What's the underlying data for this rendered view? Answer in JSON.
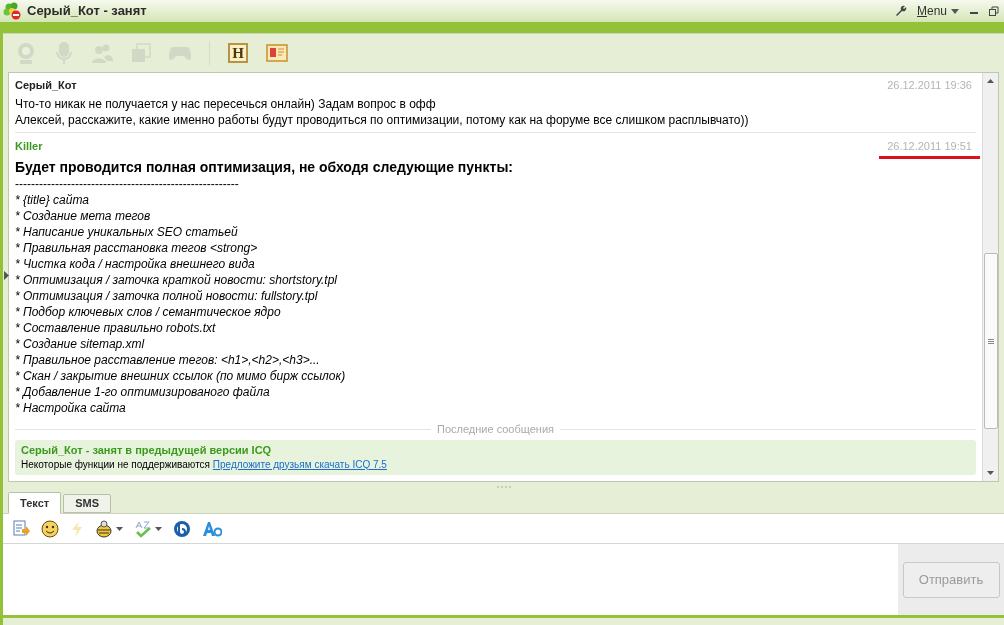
{
  "window": {
    "title": "Серый_Кот - занят",
    "menu": "Menu"
  },
  "toolbar": [
    {
      "kind": "webcam",
      "disabled": true
    },
    {
      "kind": "mic",
      "disabled": true
    },
    {
      "kind": "people",
      "disabled": true
    },
    {
      "kind": "windows",
      "disabled": true
    },
    {
      "kind": "gamepad",
      "disabled": true
    },
    {
      "kind": "separator"
    },
    {
      "kind": "letter",
      "label": "H",
      "disabled": false
    },
    {
      "kind": "card",
      "disabled": false
    }
  ],
  "messages": [
    {
      "sender": "Серый_Кот",
      "own": false,
      "time": "26.12.2011 19:36",
      "highlighted": false,
      "lines": [
        {
          "kind": "plain",
          "text": "Что-то никак не получается у нас пересечься онлайн) Задам вопрос в офф"
        },
        {
          "kind": "plain",
          "text": "Алексей, расскажите, какие именно работы будут проводиться по оптимизации, потому как на форуме все слишком расплывчато))"
        }
      ]
    },
    {
      "sender": "Killer",
      "own": true,
      "time": "26.12.2011 19:51",
      "highlighted": true,
      "lines": [
        {
          "kind": "bold",
          "text": "Будет проводится полная оптимизация, не обходя следующие пункты:"
        },
        {
          "kind": "plain",
          "text": "--------------------------------------------------------"
        },
        {
          "kind": "italic",
          "text": "* {title} сайта"
        },
        {
          "kind": "italic",
          "text": "* Создание мета тегов"
        },
        {
          "kind": "italic",
          "text": "* Написание уникальных SEO статьей"
        },
        {
          "kind": "italic",
          "text": "* Правильная расстановка тегов <strong>"
        },
        {
          "kind": "italic",
          "text": "* Чистка кода / настройка внешнего вида"
        },
        {
          "kind": "italic",
          "text": "* Оптимизация / заточка краткой новости: shortstory.tpl"
        },
        {
          "kind": "italic",
          "text": "* Оптимизация / заточка полной новости: fullstory.tpl"
        },
        {
          "kind": "italic",
          "text": "* Подбор ключевых слов / семантическое ядро"
        },
        {
          "kind": "italic",
          "text": "* Составление правильно robots.txt"
        },
        {
          "kind": "italic",
          "text": "* Создание sitemap.xml"
        },
        {
          "kind": "italic",
          "text": "* Правильное расставление тегов: <h1>,<h2>,<h3>..."
        },
        {
          "kind": "italic",
          "text": "* Скан / закрытие внешних ссылок (по мимо бирж ссылок)"
        },
        {
          "kind": "italic",
          "text": "* Добавление 1-го оптимизированого файла"
        },
        {
          "kind": "italic",
          "text": "* Настройка сайта"
        }
      ]
    }
  ],
  "recent_divider": "Последние сообщения",
  "notice": {
    "title": "Серый_Кот - занят в предыдущей версии ICQ",
    "text": "Некоторые функции не поддерживаются",
    "link": "Предложите друзьям скачать ICQ 7.5"
  },
  "tabs": [
    {
      "label": "Текст",
      "selected": true
    },
    {
      "label": "SMS",
      "selected": false
    }
  ],
  "format_toolbar": [
    {
      "kind": "paste",
      "disabled": false,
      "dropdown": false
    },
    {
      "kind": "smiley",
      "disabled": false,
      "dropdown": false
    },
    {
      "kind": "bolt",
      "disabled": true,
      "dropdown": false
    },
    {
      "kind": "bee",
      "disabled": false,
      "dropdown": true
    },
    {
      "kind": "spell",
      "disabled": false,
      "dropdown": true
    },
    {
      "kind": "translate",
      "disabled": false,
      "dropdown": false
    },
    {
      "kind": "font",
      "disabled": false,
      "dropdown": false
    }
  ],
  "send_button": {
    "label": "Отправить",
    "disabled": true
  }
}
